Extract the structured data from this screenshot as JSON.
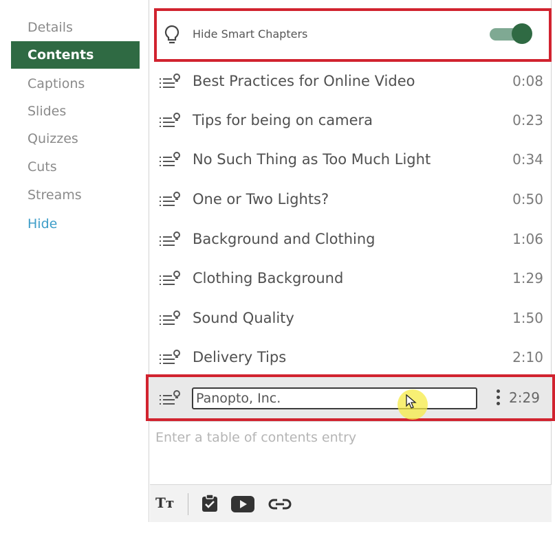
{
  "nav": {
    "items": [
      {
        "label": "Details"
      },
      {
        "label": "Contents"
      },
      {
        "label": "Captions"
      },
      {
        "label": "Slides"
      },
      {
        "label": "Quizzes"
      },
      {
        "label": "Cuts"
      },
      {
        "label": "Streams"
      },
      {
        "label": "Hide"
      }
    ]
  },
  "smart_chapters": {
    "label": "Hide Smart Chapters",
    "enabled": true,
    "icon": "lightbulb-icon"
  },
  "chapters": [
    {
      "title": "Best Practices for Online Video",
      "time": "0:08"
    },
    {
      "title": "Tips for being on camera",
      "time": "0:23"
    },
    {
      "title": "No Such Thing as Too Much Light",
      "time": "0:34"
    },
    {
      "title": "One or Two Lights?",
      "time": "0:50"
    },
    {
      "title": "Background and Clothing",
      "time": "1:06"
    },
    {
      "title": "Clothing Background",
      "time": "1:29"
    },
    {
      "title": "Sound Quality",
      "time": "1:50"
    },
    {
      "title": "Delivery Tips",
      "time": "2:10"
    }
  ],
  "editing_chapter": {
    "value": "Panopto, Inc.",
    "time": "2:29"
  },
  "entry": {
    "placeholder": "Enter a table of contents entry"
  },
  "toolbar": {
    "text_format_label": "Tт"
  },
  "colors": {
    "accent": "#2f6a43",
    "highlight": "#d1232f",
    "link": "#3d9dc8"
  }
}
